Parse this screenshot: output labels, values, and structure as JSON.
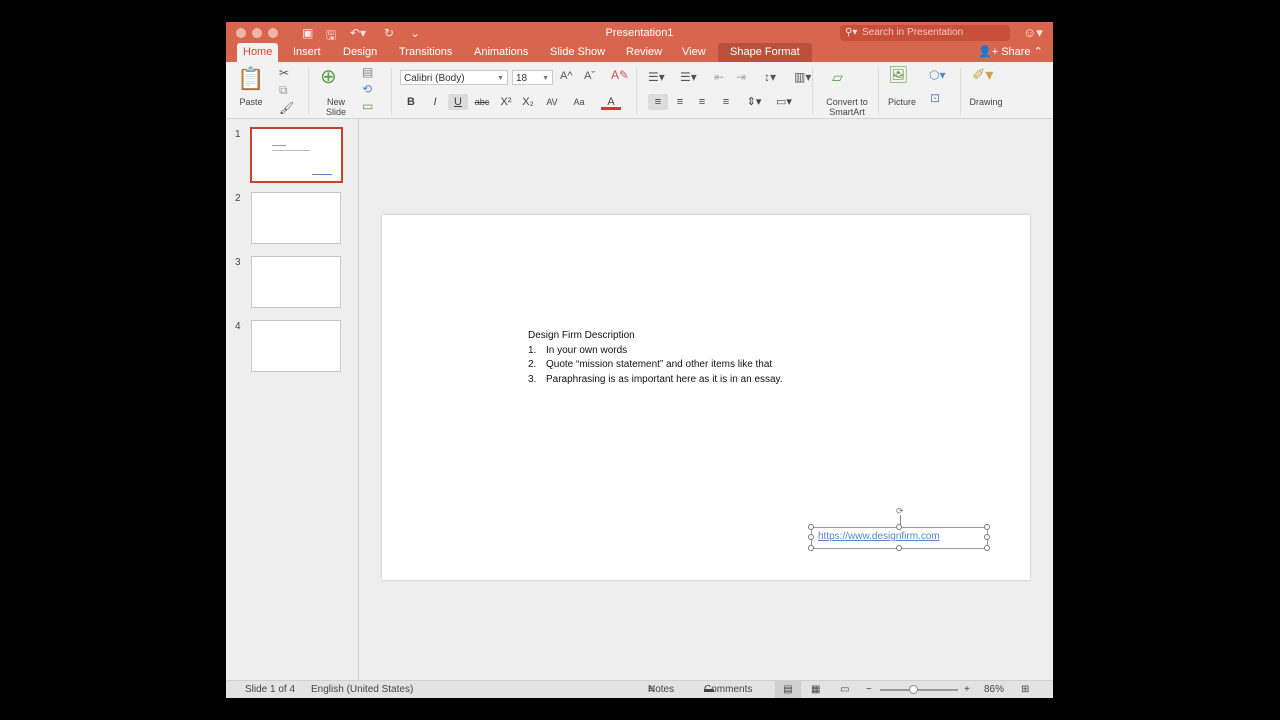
{
  "window": {
    "title": "Presentation1"
  },
  "titlebar": {
    "search_placeholder": "Search in Presentation",
    "icons": [
      "close-dot",
      "minimize-dot",
      "zoom-dot",
      "sidebar-icon",
      "save-icon",
      "undo-icon",
      "redo-icon",
      "customize-icon",
      "search-icon",
      "smiley-icon"
    ]
  },
  "tabs": [
    "Home",
    "Insert",
    "Design",
    "Transitions",
    "Animations",
    "Slide Show",
    "Review",
    "View",
    "Shape Format"
  ],
  "active_tab": "Home",
  "share_label": "Share",
  "ribbon": {
    "paste_label": "Paste",
    "new_slide_label": "New\nSlide",
    "font_name": "Calibri (Body)",
    "font_size": "18",
    "convert_label": "Convert to\nSmartArt",
    "picture_label": "Picture",
    "drawing_label": "Drawing",
    "format_buttons": [
      "B",
      "I",
      "U",
      "abc",
      "X²",
      "X₂",
      "AV",
      "Aa",
      "A"
    ]
  },
  "slides": [
    {
      "number": "1",
      "selected": true
    },
    {
      "number": "2"
    },
    {
      "number": "3"
    },
    {
      "number": "4"
    }
  ],
  "slide_content": {
    "heading": "Design Firm Description",
    "items": [
      {
        "num": "1.",
        "text": "In your own words"
      },
      {
        "num": "2.",
        "text": "Quote “mission statement” and other items like that"
      },
      {
        "num": "3.",
        "text": "Paraphrasing is as important here as it is in an essay."
      }
    ],
    "link": "https://www.designfirm.com"
  },
  "status": {
    "slide_info": "Slide 1 of 4",
    "language": "English (United States)",
    "notes_label": "Notes",
    "comments_label": "Comments",
    "zoom": "86%"
  },
  "colors": {
    "accent": "#d8664f",
    "active_tab_text": "#d24726",
    "link": "#5b87c7"
  }
}
